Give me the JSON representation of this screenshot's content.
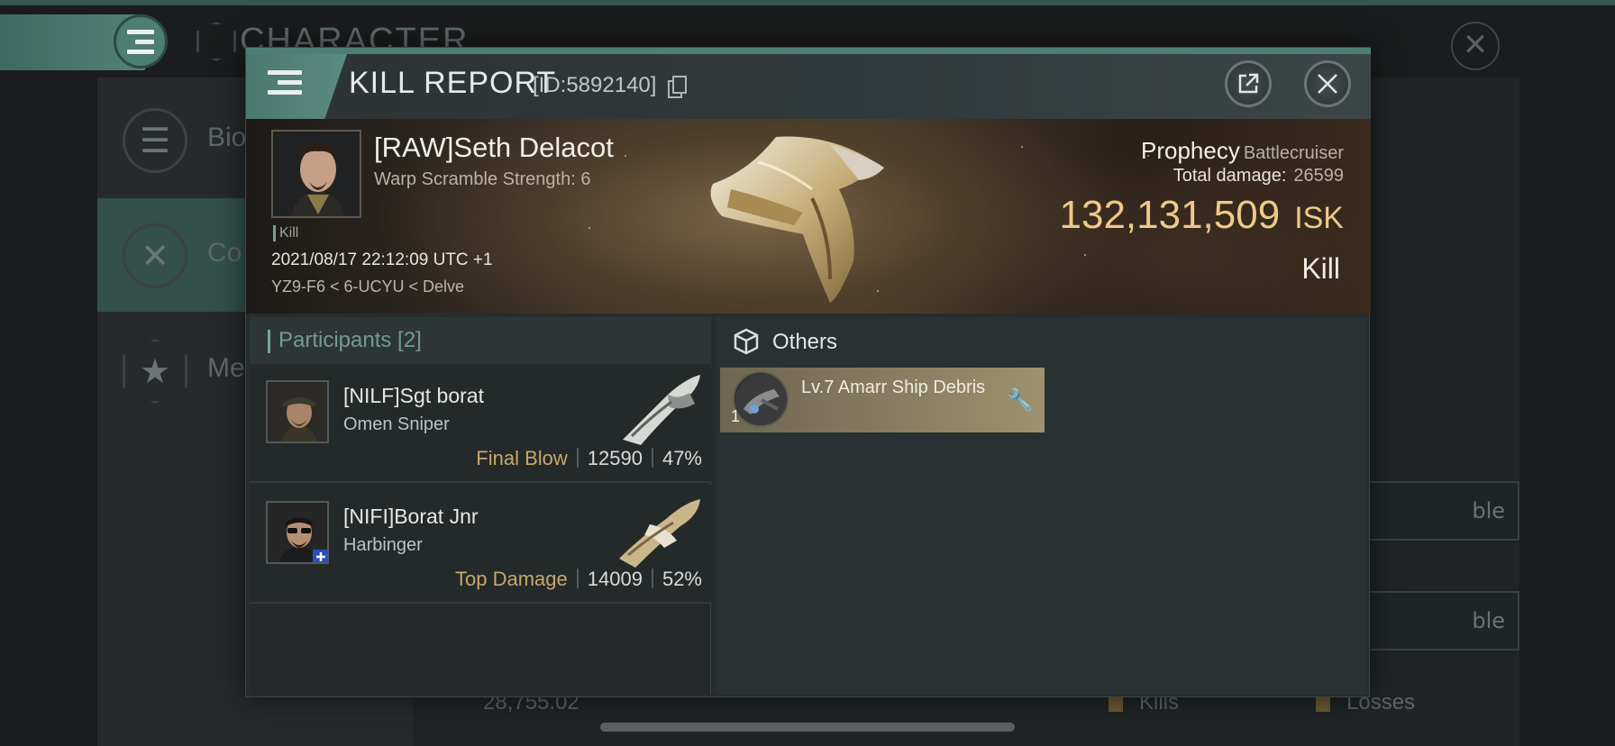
{
  "background": {
    "title": "CHARACTER",
    "side_items": [
      "Bio",
      "Co",
      "Me"
    ],
    "bottom_value": "28,755.02",
    "bottom_kills": "Kills",
    "bottom_losses": "Losses",
    "ghost_button_1": "ble",
    "ghost_button_2": "ble"
  },
  "modal": {
    "title": "KILL REPORT",
    "report_id": "[ID:5892140]",
    "share_icon": "share-icon",
    "close_icon": "close-icon"
  },
  "victim": {
    "name": "[RAW]Seth Delacot",
    "warp_scramble": "Warp Scramble Strength: 6",
    "tag": "Kill",
    "datetime": "2021/08/17 22:12:09 UTC +1",
    "location": "YZ9-F6 < 6-UCYU < Delve",
    "ship_name": "Prophecy",
    "ship_class": "Battlecruiser",
    "total_damage_label": "Total damage:",
    "total_damage": "26599",
    "isk_value": "132,131,509",
    "isk_unit": "ISK",
    "result": "Kill"
  },
  "participants": {
    "header": "Participants [2]",
    "rows": [
      {
        "name": "[NILF]Sgt borat",
        "ship": "Omen Sniper",
        "tag": "Final Blow",
        "damage": "12590",
        "percent": "47%"
      },
      {
        "name": "[NIFI]Borat Jnr",
        "ship": "Harbinger",
        "tag": "Top Damage",
        "damage": "14009",
        "percent": "52%"
      }
    ]
  },
  "others": {
    "header": "Others",
    "items": [
      {
        "name": "Lv.7 Amarr Ship Debris",
        "quantity": "1",
        "action_icon": "wrench-icon"
      }
    ]
  },
  "colors": {
    "accent_teal": "#4e7f76",
    "isk_gold": "#eec987",
    "tag_gold": "#c9a76a",
    "item_card": "#9e916f"
  }
}
